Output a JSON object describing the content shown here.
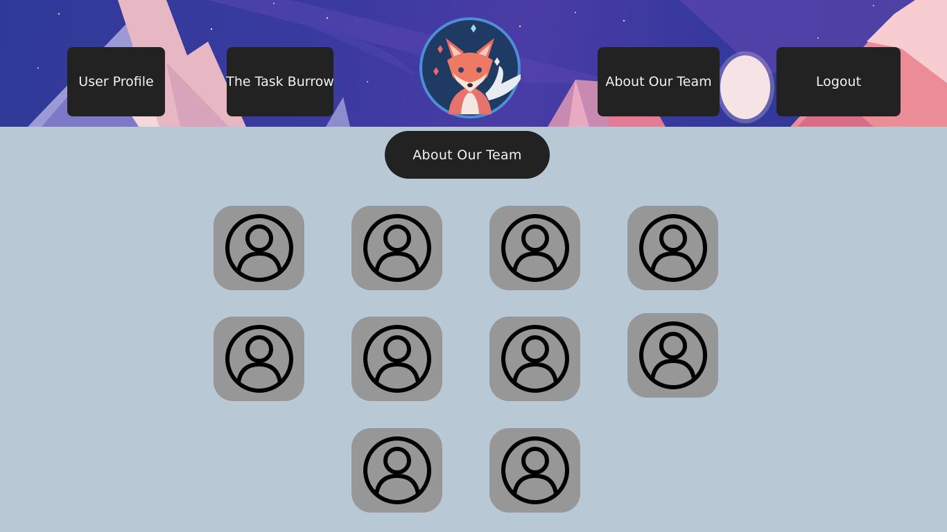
{
  "nav": {
    "user_profile": "User Profile",
    "task_burrow": "The Task Burrow",
    "about_team": "About Our Team",
    "logout": "Logout"
  },
  "page": {
    "title": "About Our Team"
  },
  "team": {
    "member_count": 10,
    "icon": "user-avatar-icon"
  },
  "colors": {
    "button_bg": "#222222",
    "page_bg": "#b8c8d5",
    "avatar_tile": "#979797"
  }
}
